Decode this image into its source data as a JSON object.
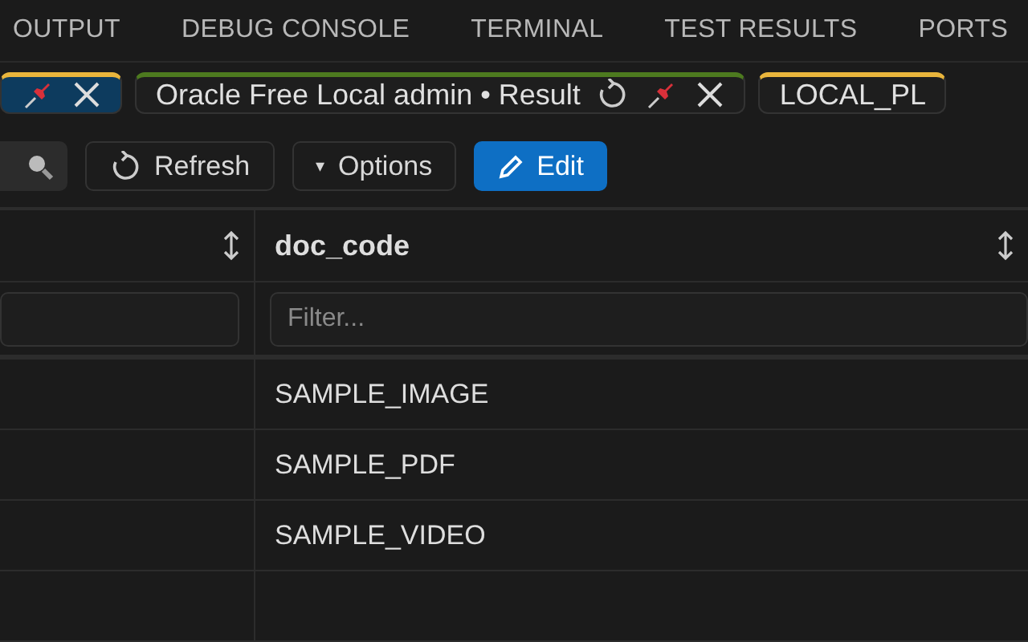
{
  "panel_tabs": [
    {
      "label": "OUTPUT",
      "selected": false
    },
    {
      "label": "DEBUG CONSOLE",
      "selected": false
    },
    {
      "label": "TERMINAL",
      "selected": false
    },
    {
      "label": "TEST RESULTS",
      "selected": false
    },
    {
      "label": "PORTS",
      "selected": false
    }
  ],
  "editor_tabs": [
    {
      "selected": true,
      "color": "#e9b53c",
      "pinned": true
    },
    {
      "label": "Oracle Free Local admin • Result",
      "selected": false,
      "color": "#4d7a1f",
      "pinned": true
    },
    {
      "label": "LOCAL_PL",
      "selected": false,
      "color": "#e9b53c",
      "pinned": false
    }
  ],
  "toolbar": {
    "refresh": "Refresh",
    "options": "Options",
    "options_caret": "▾",
    "edit": "Edit"
  },
  "table": {
    "columns": [
      {
        "sortable": true
      },
      {
        "label": "doc_code",
        "sortable": true,
        "placeholder": "Filter..."
      }
    ],
    "rows": [
      [
        "",
        "SAMPLE_IMAGE"
      ],
      [
        "",
        "SAMPLE_PDF"
      ],
      [
        "",
        "SAMPLE_VIDEO"
      ],
      [
        "",
        ""
      ]
    ]
  }
}
